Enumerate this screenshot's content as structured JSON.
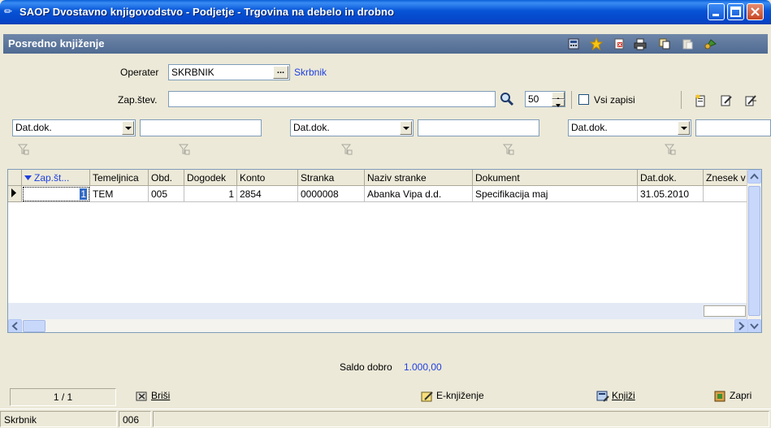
{
  "window": {
    "title": "SAOP Dvostavno knjigovodstvo - Podjetje - Trgovina na debelo in drobno"
  },
  "form": {
    "title": "Posredno knjiženje"
  },
  "filters": {
    "operater_label": "Operater",
    "operater_value": "SKRBNIK",
    "operater_browse": "...",
    "operater_name": "Skrbnik",
    "zap_stev_label": "Zap.štev.",
    "zap_stev_value": "",
    "page_size": "50",
    "vsi_zapisi_label": "Vsi zapisi",
    "vsi_zapisi_checked": false,
    "sort_combos": [
      {
        "value": "Dat.dok.",
        "text": ""
      },
      {
        "value": "Dat.dok.",
        "text": ""
      },
      {
        "value": "Dat.dok.",
        "text": ""
      }
    ]
  },
  "grid": {
    "columns": [
      "Zap.št...",
      "Temeljnica",
      "Obd.",
      "Dogodek",
      "Konto",
      "Stranka",
      "Naziv stranke",
      "Dokument",
      "Dat.dok.",
      "Znesek v"
    ],
    "sort_column": "Zap.št...",
    "rows": [
      {
        "zap": "1",
        "temeljnica": "TEM",
        "obd": "005",
        "dogodek": "1",
        "konto": "2854",
        "stranka": "0000008",
        "naziv": "Abanka Vipa d.d.",
        "dokument": "Specifikacija maj",
        "datdok": "31.05.2010",
        "znesek": ""
      }
    ]
  },
  "saldo": {
    "label": "Saldo dobro",
    "value": "1.000,00"
  },
  "footer": {
    "record_position": "1 / 1",
    "brisi_label": "Briši",
    "eknjizenje_label": "E-knjiženje",
    "knjizi_label": "Knjiži",
    "zapri_label": "Zapri"
  },
  "statusbar": {
    "user": "Skrbnik",
    "code": "006",
    "extra": ""
  },
  "colors": {
    "title_blue": "#0653D6",
    "form_header": "#5B7399",
    "accent_link": "#1F3FE0",
    "window_bg": "#ECE9D8"
  }
}
